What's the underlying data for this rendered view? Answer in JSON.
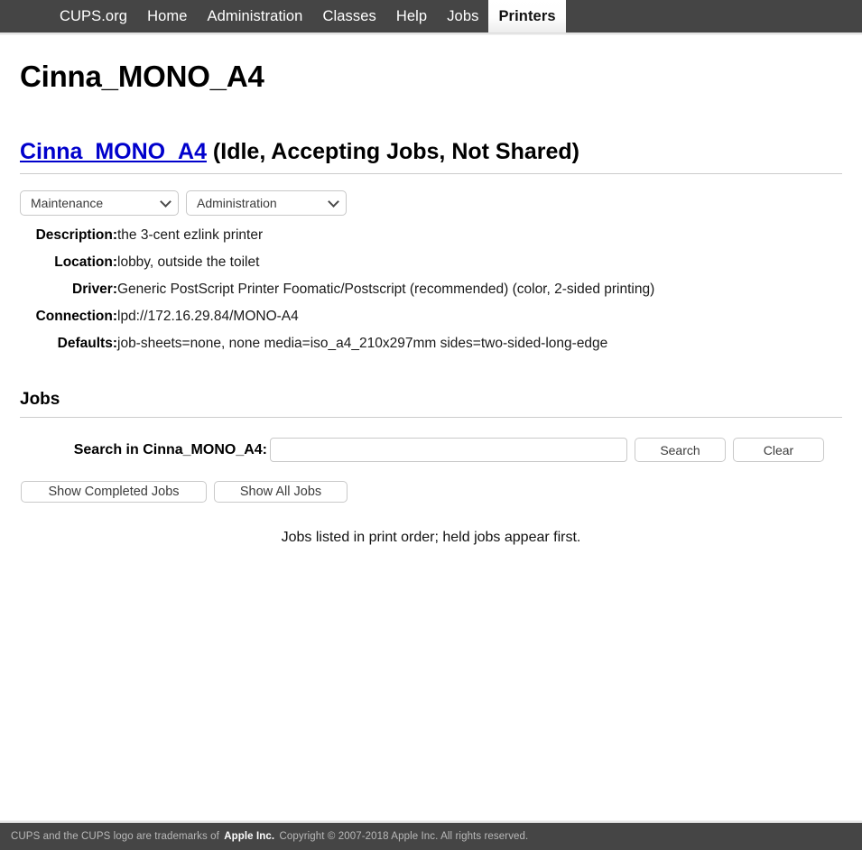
{
  "navbar": {
    "items": [
      {
        "label": "CUPS.org",
        "active": false
      },
      {
        "label": "Home",
        "active": false
      },
      {
        "label": "Administration",
        "active": false
      },
      {
        "label": "Classes",
        "active": false
      },
      {
        "label": "Help",
        "active": false
      },
      {
        "label": "Jobs",
        "active": false
      },
      {
        "label": "Printers",
        "active": true
      }
    ],
    "background_color": "#454545",
    "active_text_color": "#111111"
  },
  "page": {
    "title": "Cinna_MONO_A4",
    "printer_link": "Cinna_MONO_A4",
    "printer_status": " (Idle, Accepting Jobs, Not Shared)",
    "link_color": "#0000cc"
  },
  "controls": {
    "maintenance_select": "Maintenance",
    "administration_select": "Administration"
  },
  "attributes": [
    {
      "label": "Description:",
      "value": "the 3-cent ezlink printer"
    },
    {
      "label": "Location:",
      "value": "lobby, outside the toilet"
    },
    {
      "label": "Driver:",
      "value": "Generic PostScript Printer Foomatic/Postscript (recommended) (color, 2-sided printing)"
    },
    {
      "label": "Connection:",
      "value": "lpd://172.16.29.84/MONO-A4"
    },
    {
      "label": "Defaults:",
      "value": "job-sheets=none, none media=iso_a4_210x297mm sides=two-sided-long-edge"
    }
  ],
  "jobs": {
    "heading": "Jobs",
    "search_label": "Search in Cinna_MONO_A4:",
    "search_value": "",
    "search_placeholder": "",
    "search_button": "Search",
    "clear_button": "Clear",
    "show_completed_button": "Show Completed Jobs",
    "show_all_button": "Show All Jobs",
    "note": "Jobs listed in print order; held jobs appear first."
  },
  "footer": {
    "text_before": "CUPS and the CUPS logo are trademarks of ",
    "link": "Apple Inc.",
    "text_after": " Copyright © 2007-2018 Apple Inc. All rights reserved."
  }
}
